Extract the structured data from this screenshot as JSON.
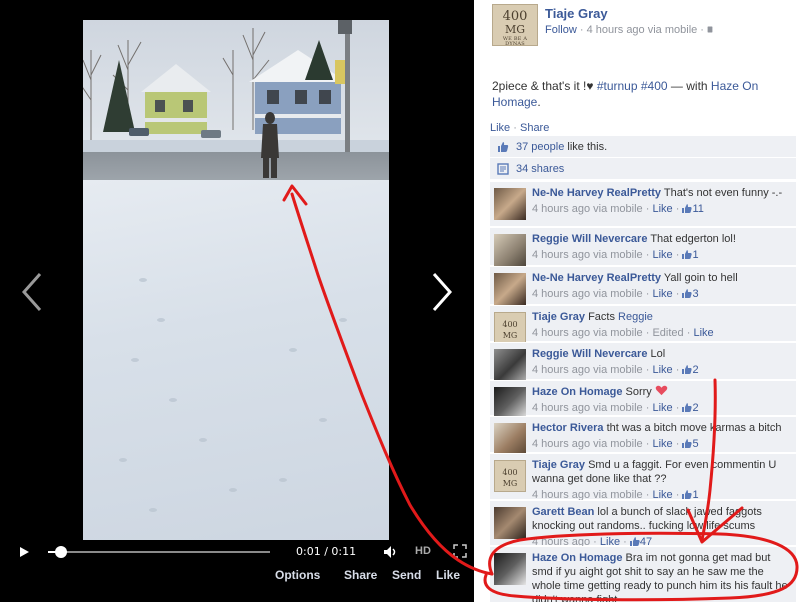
{
  "video": {
    "time": "0:01 / 0:11",
    "progress": 0.06,
    "hd_label": "HD"
  },
  "actions": {
    "options": "Options",
    "share": "Share",
    "send": "Send",
    "like": "Like"
  },
  "post": {
    "avatar_text": "400",
    "avatar_sub": "MG",
    "avatar_small": "WE BE A DYNAS",
    "poster": "Tiaje Gray",
    "follow": "Follow",
    "meta": " · 4 hours ago via mobile ·",
    "status_text": "2piece & that's it !♥ ",
    "hashtag1": "#turnup",
    "hashtag2": "#400",
    "with_text": " — with ",
    "with_name": "Haze On Homage",
    "with_end": ".",
    "like_link": "Like",
    "share_link": "Share",
    "likes_count": "37 people",
    "likes_suffix": " like this.",
    "shares_count": "34 shares"
  },
  "comments": [
    {
      "author": "Ne-Ne Harvey RealPretty",
      "text": "That's not even funny -.-",
      "time": "4 hours ago via mobile",
      "like": "Like",
      "likes": "11"
    },
    {
      "author": "Reggie Will Nevercare",
      "text": "That edgerton lol!",
      "time": "4 hours ago via mobile",
      "like": "Like",
      "likes": "1"
    },
    {
      "author": "Ne-Ne Harvey RealPretty",
      "text": "Yall goin to hell",
      "time": "4 hours ago via mobile",
      "like": "Like",
      "likes": "3"
    },
    {
      "author": "Tiaje Gray",
      "text": "Facts",
      "mention": "Reggie",
      "time": "4 hours ago via mobile",
      "edited": "Edited",
      "like": "Like"
    },
    {
      "author": "Reggie Will Nevercare",
      "text": "Lol",
      "time": "4 hours ago via mobile",
      "like": "Like",
      "likes": "2"
    },
    {
      "author": "Haze On Homage",
      "text": "Sorry",
      "time": "4 hours ago via mobile",
      "like": "Like",
      "likes": "2"
    },
    {
      "author": "Hector Rivera",
      "text": "tht was a bitch move karmas a bitch",
      "time": "4 hours ago via mobile",
      "like": "Like",
      "likes": "5"
    },
    {
      "author": "Tiaje Gray",
      "text": "Smd u a faggit. For even commentin U wanna get done like that ??",
      "time": "4 hours ago via mobile",
      "like": "Like",
      "likes": "1"
    },
    {
      "author": "Garett Bean",
      "text": "lol a bunch of slack jawed faggots knocking out randoms.. fucking low life scums",
      "time": "4 hours ago",
      "like": "Like",
      "likes": "47"
    },
    {
      "author": "Haze On Homage",
      "text": "Bra im not gonna get mad but smd if yu aight got shit to say an he saw me the whole time getting ready to punch him its his fault he didn't wanna fight"
    }
  ],
  "colors": {
    "link": "#3b5998",
    "meta_gray": "#90949c",
    "ufi_bg": "#eef0f4",
    "annotation_red": "#e11a1a",
    "heart": "#e74c5e"
  }
}
